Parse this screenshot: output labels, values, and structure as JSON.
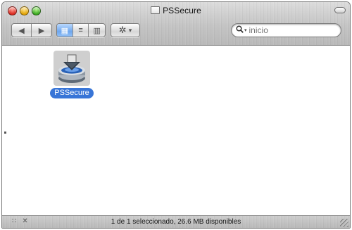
{
  "window": {
    "title": "PSSecure"
  },
  "toolbar": {
    "back_icon": "◀",
    "forward_icon": "▶",
    "view_icons": [
      "▦",
      "≡",
      "▥"
    ],
    "action_icon": "✲",
    "action_caret": "▾"
  },
  "search": {
    "placeholder": "inicio",
    "value": "inicio"
  },
  "content": {
    "items": [
      {
        "label": "PSSecure",
        "icon": "installer-disk-icon",
        "selected": true
      }
    ]
  },
  "statusbar": {
    "text": "1 de 1 seleccionado, 26.6 MB disponibles",
    "left_icons": [
      "∷",
      "✕"
    ]
  },
  "colors": {
    "selection": "#3875d7",
    "view_active": "#6fa7ee"
  }
}
